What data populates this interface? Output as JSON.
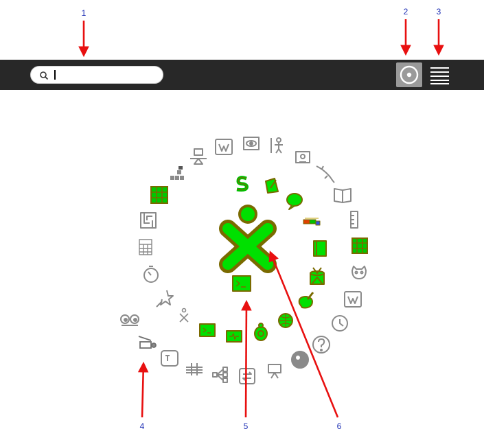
{
  "toolbar": {
    "search": {
      "value": "",
      "placeholder": ""
    },
    "favorites_view_icon": "circle-view-icon",
    "list_view_icon": "list-view-icon"
  },
  "annotations": {
    "labels": [
      "1",
      "2",
      "3",
      "4",
      "5",
      "6"
    ],
    "arrow_color": "#e81010",
    "label_color": "#1e2fb4"
  },
  "colors": {
    "toolbar_bg": "#282828",
    "active_fill": "#00e000",
    "active_stroke": "#7a6a00",
    "inactive_stroke": "#8a8a8a"
  },
  "ring_icons": [
    "physics-icon",
    "wikipedia-icon",
    "eye-icon",
    "measure-person-icon",
    "portfolio-icon",
    "dolphin-icon",
    "book-icon",
    "ruler-icon",
    "grid-game-icon",
    "cat-icon",
    "wikipedia-es-icon",
    "clock-icon",
    "help-icon",
    "moon-icon",
    "presentation-icon",
    "swap-icon",
    "mindmap-icon",
    "music-staff-icon",
    "typing-icon",
    "music-creator-icon",
    "eyes-icon",
    "star-icon",
    "stopwatch-icon",
    "calculator-icon",
    "maze-icon",
    "green-grid-icon",
    "blocks-icon"
  ],
  "inner_icons": [
    "scratch-icon",
    "write-icon",
    "chat-icon",
    "fractions-icon",
    "journal-icon",
    "drum-icon",
    "paint-icon",
    "browse-icon",
    "turtle-icon",
    "record-icon",
    "terminal-icon",
    "jump-icon",
    "terminal-center-icon"
  ],
  "home_icon": "xo-owner-icon"
}
